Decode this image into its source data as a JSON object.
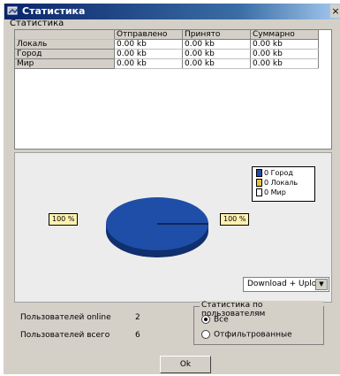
{
  "window": {
    "title": "Статистика",
    "close_glyph": "×"
  },
  "caption": "Статистика",
  "table": {
    "columns": [
      "Отправлено",
      "Принято",
      "Суммарно"
    ],
    "rows": [
      {
        "label": "Локаль",
        "values": [
          "0.00 kb",
          "0.00 kb",
          "0.00 kb"
        ]
      },
      {
        "label": "Город",
        "values": [
          "0.00 kb",
          "0.00 kb",
          "0.00 kb"
        ]
      },
      {
        "label": "Мир",
        "values": [
          "0.00 kb",
          "0.00 kb",
          "0.00 kb"
        ]
      }
    ]
  },
  "chart": {
    "legend": [
      {
        "label": "0 Город",
        "color": "#1f4ea8"
      },
      {
        "label": "0 Локаль",
        "color": "#e8c43c"
      },
      {
        "label": "0 Мир",
        "color": "#ffffff"
      }
    ],
    "left_label": "100 %",
    "right_label": "100 %",
    "pie_color": "#1f4ea8",
    "mode": {
      "selected": "Download + Upload",
      "arrow": "▼"
    }
  },
  "chart_data": {
    "type": "pie",
    "categories": [
      "Город",
      "Локаль",
      "Мир"
    ],
    "values": [
      0,
      0,
      0
    ],
    "slice_labels": [
      "100 %",
      "100 %"
    ]
  },
  "stats": {
    "online_label": "Пользователей online",
    "online_value": "2",
    "total_label": "Пользователей всего",
    "total_value": "6"
  },
  "user_stats": {
    "title": "Статистика по пользователям",
    "options": [
      {
        "label": "Все",
        "checked": true
      },
      {
        "label": "Отфильтрованные",
        "checked": false
      }
    ]
  },
  "ok_label": "Ok"
}
